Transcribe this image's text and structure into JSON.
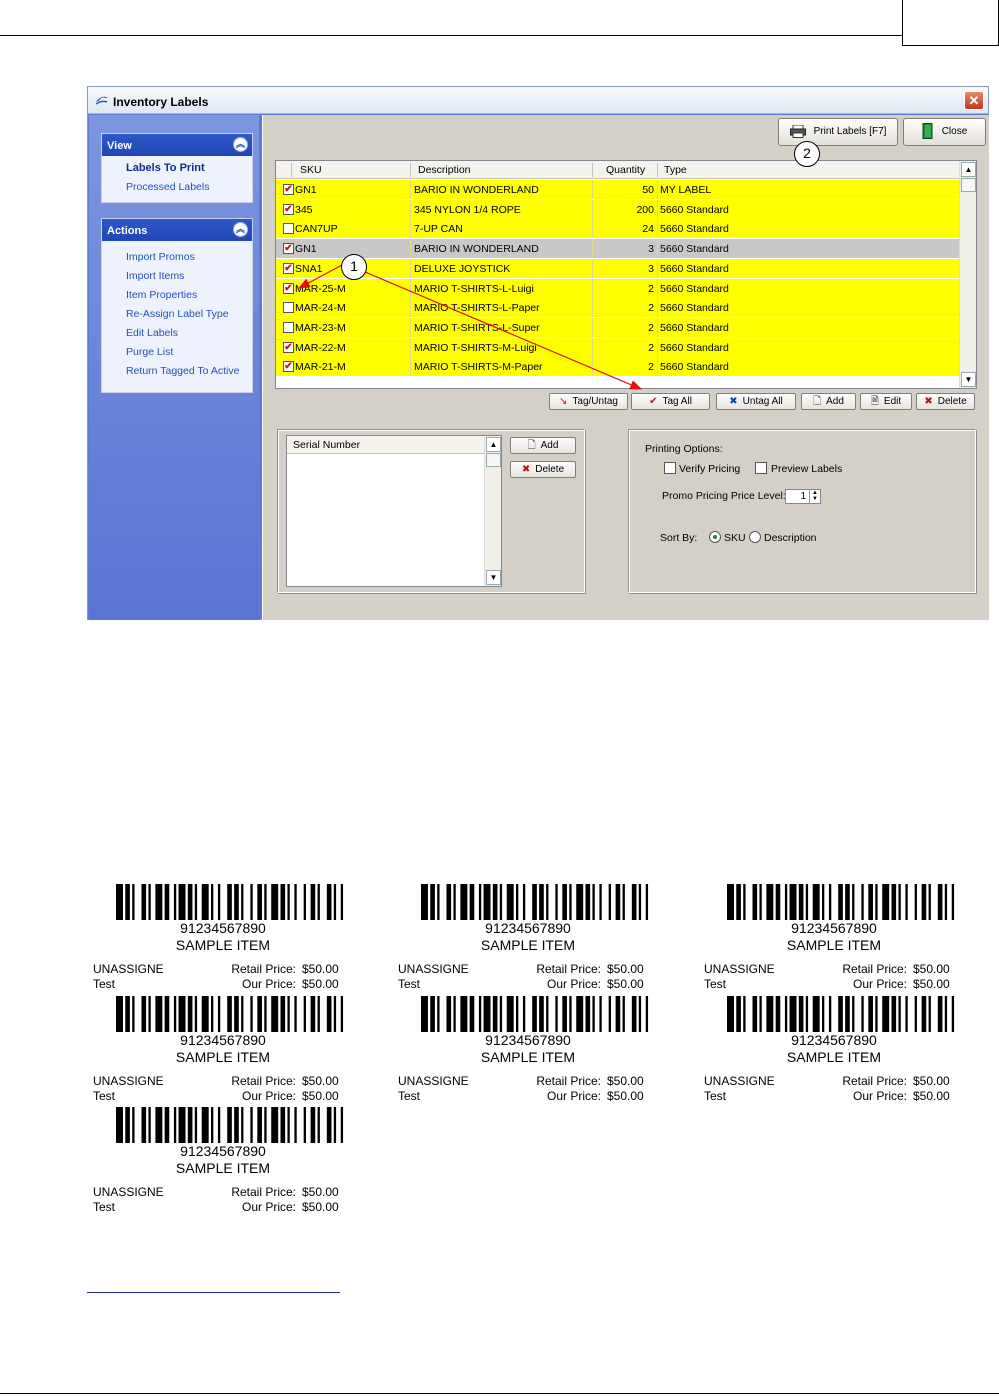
{
  "window": {
    "title": "Inventory Labels",
    "close_glyph": "✕"
  },
  "taskpane": {
    "view": {
      "header": "View",
      "items": [
        "Labels To Print",
        "Processed Labels"
      ]
    },
    "actions": {
      "header": "Actions",
      "items": [
        "Import Promos",
        "Import Items",
        "Item Properties",
        "Re-Assign Label Type",
        "Edit Labels",
        "Purge List",
        "Return Tagged To Active"
      ]
    }
  },
  "toolbar": {
    "print_label": "Print Labels [F7]",
    "close_label": "Close"
  },
  "grid": {
    "columns": {
      "sku": "SKU",
      "description": "Description",
      "quantity": "Quantity",
      "type": "Type"
    },
    "rows": [
      {
        "checked": true,
        "sku": "GN1",
        "description": "BARIO IN WONDERLAND",
        "quantity": "50",
        "type": "MY LABEL"
      },
      {
        "checked": true,
        "sku": "345",
        "description": "345 NYLON 1/4 ROPE",
        "quantity": "200",
        "type": "5660 Standard"
      },
      {
        "checked": false,
        "sku": "CAN7UP",
        "description": "7-UP CAN",
        "quantity": "24",
        "type": "5660 Standard"
      },
      {
        "checked": true,
        "sku": "GN1",
        "description": "BARIO IN WONDERLAND",
        "quantity": "3",
        "type": "5660 Standard"
      },
      {
        "checked": true,
        "sku": "SNA1",
        "description": "DELUXE JOYSTICK",
        "quantity": "3",
        "type": "5660 Standard"
      },
      {
        "checked": true,
        "sku": "MAR-25-M",
        "description": "MARIO T-SHIRTS-L-Luigi",
        "quantity": "2",
        "type": "5660 Standard"
      },
      {
        "checked": false,
        "sku": "MAR-24-M",
        "description": "MARIO T-SHIRTS-L-Paper",
        "quantity": "2",
        "type": "5660 Standard"
      },
      {
        "checked": false,
        "sku": "MAR-23-M",
        "description": "MARIO T-SHIRTS-L-Super",
        "quantity": "2",
        "type": "5660 Standard"
      },
      {
        "checked": true,
        "sku": "MAR-22-M",
        "description": "MARIO T-SHIRTS-M-Luigi",
        "quantity": "2",
        "type": "5660 Standard"
      },
      {
        "checked": true,
        "sku": "MAR-21-M",
        "description": "MARIO T-SHIRTS-M-Paper",
        "quantity": "2",
        "type": "5660 Standard"
      }
    ],
    "check_glyph": "✔"
  },
  "grid_buttons": {
    "tag_untag": "Tag/Untag",
    "tag_all": "Tag All",
    "untag_all": "Untag All",
    "add": "Add",
    "edit": "Edit",
    "delete": "Delete"
  },
  "serial": {
    "header": "Serial Number",
    "add": "Add",
    "delete": "Delete"
  },
  "printing_options": {
    "title": "Printing Options:",
    "verify_pricing": "Verify Pricing",
    "preview_labels": "Preview Labels",
    "promo_level_label": "Promo Pricing Price Level:",
    "promo_level_value": "1",
    "sort_by_label": "Sort By:",
    "sort_sku": "SKU",
    "sort_description": "Description"
  },
  "callouts": {
    "one": "1",
    "two": "2"
  },
  "label_sample": {
    "code": "91234567890",
    "item": "SAMPLE ITEM",
    "left1": "UNASSIGNE",
    "left2": "Test",
    "retail_label": "Retail Price:",
    "retail_value": "$50.00",
    "our_label": "Our Price:",
    "our_value": "$50.00"
  },
  "colors": {
    "highlight_row": "#ffff00",
    "selected_row": "#c8c8c8",
    "taskpane": "#5a74d4",
    "annotation": "#e01010"
  }
}
